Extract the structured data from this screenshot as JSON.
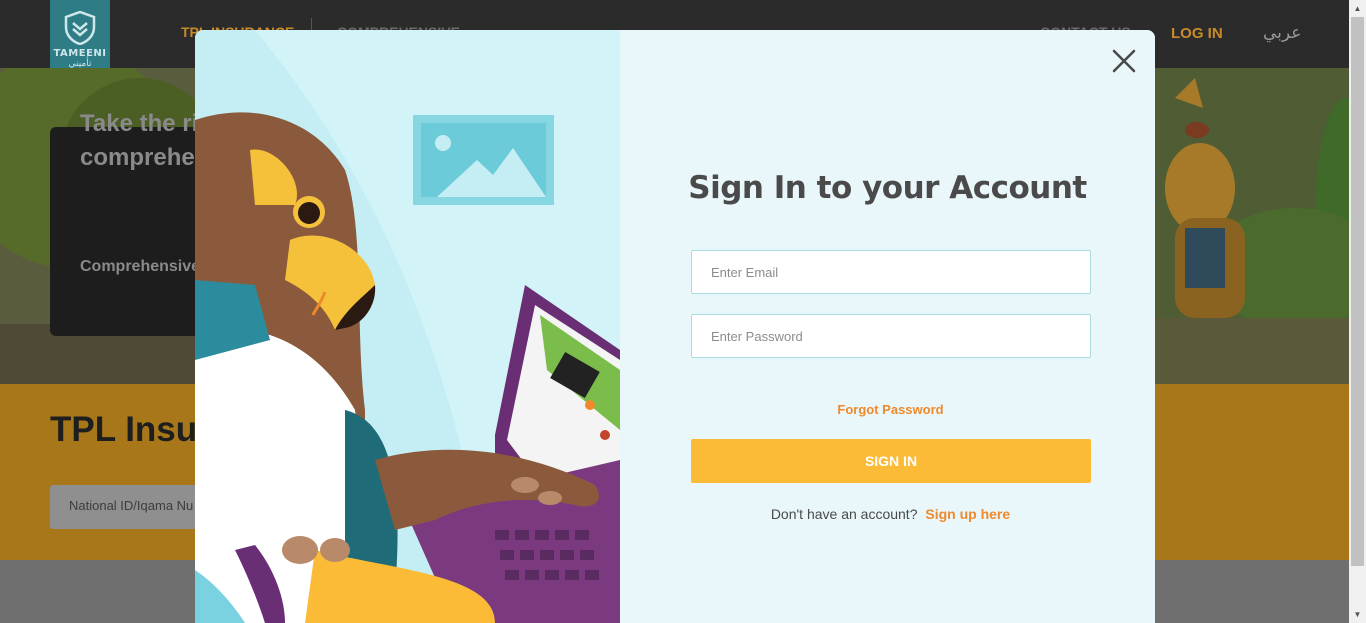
{
  "header": {
    "logo_text": "TAMEENI",
    "logo_arabic": "تأميني",
    "nav_tpl": "TPL INSURANCE",
    "nav_comprehensive": "COMPREHENSIVE",
    "nav_contact": "CONTACT US",
    "login": "LOG IN",
    "language": "عربي"
  },
  "hero": {
    "title_line1": "Take the ri",
    "title_line2": "comprehe",
    "subtitle": "Comprehensive"
  },
  "tpl": {
    "title": "TPL Insur",
    "id_placeholder": "National ID/Iqama Nu"
  },
  "modal": {
    "title": "Sign In to your Account",
    "email_placeholder": "Enter Email",
    "password_placeholder": "Enter Password",
    "forgot_password": "Forgot Password",
    "sign_in_button": "SIGN IN",
    "no_account_text": "Don't have an account?",
    "sign_up_link": "Sign up here"
  },
  "colors": {
    "accent_orange": "#ee8a2c",
    "button_yellow": "#fbbb37",
    "panel_bg": "#e9f7fb",
    "art_bg": "#c4eef4"
  }
}
